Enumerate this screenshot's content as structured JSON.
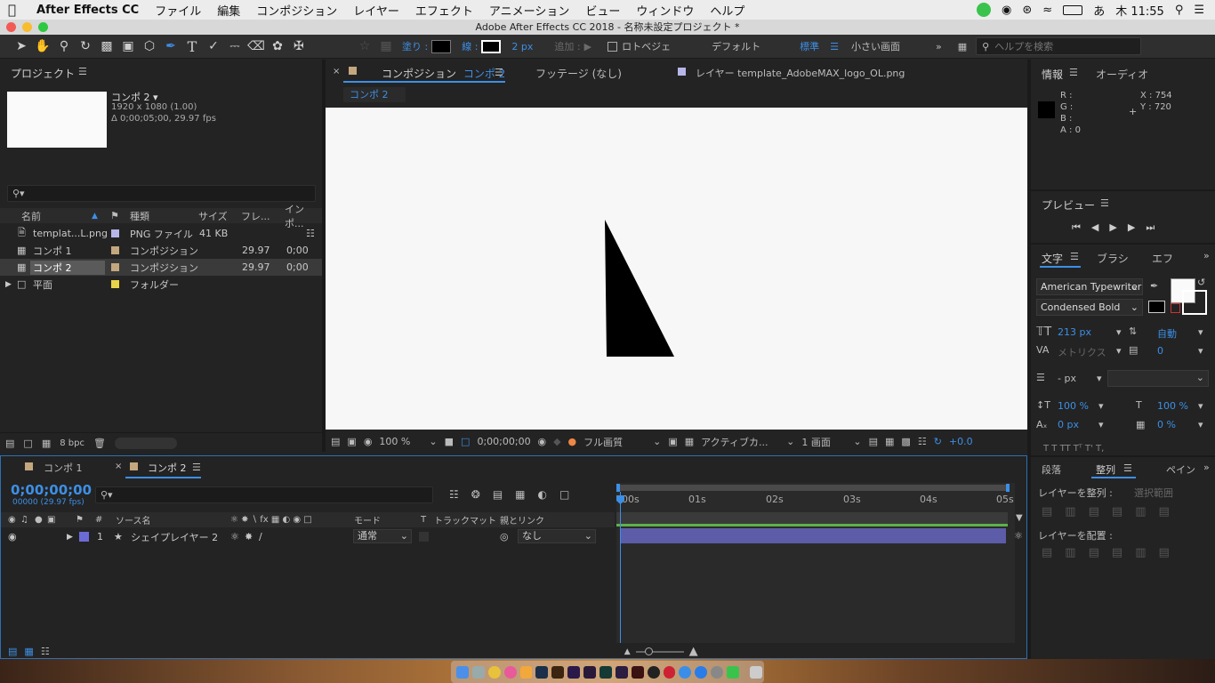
{
  "menubar": {
    "app": "After Effects CC",
    "items": [
      "ファイル",
      "編集",
      "コンポジション",
      "レイヤー",
      "エフェクト",
      "アニメーション",
      "ビュー",
      "ウィンドウ",
      "ヘルプ"
    ],
    "clock": "木 11:55",
    "ime": "あ"
  },
  "window": {
    "title": "Adobe After Effects CC 2018 - 名称未設定プロジェクト *"
  },
  "toolbar": {
    "fill_label": "塗り :",
    "stroke_label": "線 :",
    "stroke_width": "2 px",
    "add_label": "追加 :",
    "rotobezier": "ロトベジェ",
    "default": "デフォルト",
    "standard": "標準",
    "small_screen": "小さい画面",
    "help_search_placeholder": "ヘルプを検索"
  },
  "project": {
    "title": "プロジェクト",
    "selected_name": "コンポ 2 ▾",
    "selected_dims": "1920 x 1080 (1.00)",
    "selected_duration": "Δ 0;00;05;00, 29.97 fps",
    "cols": {
      "name": "名前",
      "type": "種類",
      "size": "サイズ",
      "frame": "フレ...",
      "inpoint": "インポ..."
    },
    "items": [
      {
        "name": "templat...L.png",
        "color": "#b7b6e8",
        "type": "PNG ファイル",
        "size": "41 KB",
        "fps": "",
        "in": ""
      },
      {
        "name": "コンポ 1",
        "color": "#c4a77e",
        "type": "コンポジション",
        "size": "",
        "fps": "29.97",
        "in": "0;00"
      },
      {
        "name": "コンポ 2",
        "color": "#c4a77e",
        "type": "コンポジション",
        "size": "",
        "fps": "29.97",
        "in": "0;00"
      },
      {
        "name": "平面",
        "color": "#e8d44a",
        "type": "フォルダー",
        "size": "",
        "fps": "",
        "in": ""
      }
    ],
    "bpc": "8 bpc"
  },
  "composition": {
    "tab_label": "コンポジション",
    "tab_comp": "コンポ 2",
    "footage_tab": "フッテージ (なし)",
    "layer_tab": "レイヤー template_AdobeMAX_logo_OL.png",
    "sub_tab": "コンポ 2",
    "zoom": "100 %",
    "timecode": "0;00;00;00",
    "quality": "フル画質",
    "camera": "アクティブカ...",
    "views": "1 画面",
    "exposure": "+0.0"
  },
  "info": {
    "title": "情報",
    "audio_tab": "オーディオ",
    "r": "R :",
    "g": "G :",
    "b": "B :",
    "a": "A : 0",
    "x": "X : 754",
    "y": "Y : 720"
  },
  "preview": {
    "title": "プレビュー"
  },
  "character": {
    "title": "文字",
    "brush_tab": "ブラシ",
    "effect_tab": "エフ",
    "font": "American Typewriter",
    "style": "Condensed Bold",
    "size": "213 px",
    "leading": "自動",
    "kerning": "メトリクス",
    "tracking": "0",
    "stroke_px": "- px",
    "vscale": "100 %",
    "hscale": "100 %",
    "baseline": "0 px",
    "tsume": "0 %"
  },
  "paragraph": {
    "tab1": "段落",
    "tab2": "整列",
    "tab3": "ペイン",
    "align_label": "レイヤーを整列 :",
    "align_target": "選択範囲",
    "distribute_label": "レイヤーを配置 :"
  },
  "timeline": {
    "tab1": "コンポ 1",
    "tab2": "コンポ 2",
    "timecode": "0;00;00;00",
    "fps": "00000 (29.97 fps)",
    "cols": {
      "num": "#",
      "source": "ソース名",
      "mode": "モード",
      "t": "T",
      "trkmat": "トラックマット",
      "parent": "親とリンク"
    },
    "layers": [
      {
        "num": "1",
        "name": "シェイプレイヤー 2",
        "mode": "通常",
        "parent": "なし",
        "color": "#6b6bd8"
      }
    ],
    "ruler": [
      "00s",
      "01s",
      "02s",
      "03s",
      "04s",
      "05s"
    ]
  }
}
